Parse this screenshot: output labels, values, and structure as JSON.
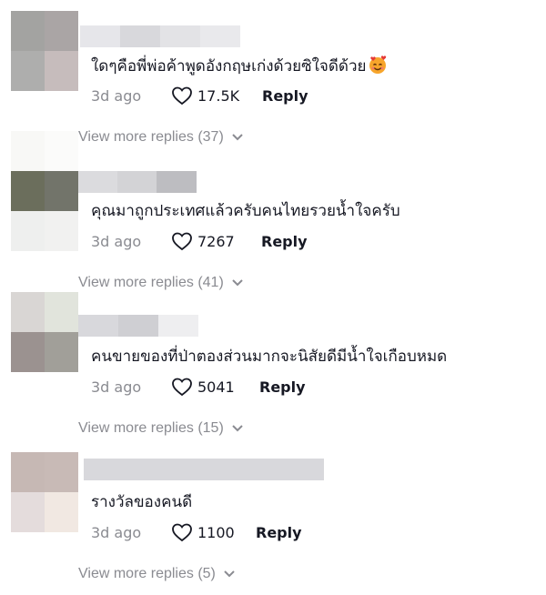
{
  "comments": [
    {
      "text": "ใดๆคือพี่พ่อค้าพูดอังกฤษเก่งด้วยซิใจดีด้วย",
      "emoji": "smiling-face-with-hearts",
      "time": "3d ago",
      "likes": "17.5K",
      "reply_label": "Reply",
      "more_replies": "View more replies (37)"
    },
    {
      "text": "คุณมาถูกประเทศแล้วครับคนไทยรวยน้ำใจครับ",
      "time": "3d ago",
      "likes": "7267",
      "reply_label": "Reply",
      "more_replies": "View more replies (41)"
    },
    {
      "text": "คนขายของที่ป่าตองส่วนมากจะนิสัยดีมีน้ำใจเกือบหมด",
      "time": "3d ago",
      "likes": "5041",
      "reply_label": "Reply",
      "more_replies": "View more replies (15)"
    },
    {
      "text": "รางวัลของคนดี",
      "time": "3d ago",
      "likes": "1100",
      "reply_label": "Reply",
      "more_replies": "View more replies (5)"
    }
  ],
  "colors": {
    "text": "#161823",
    "muted": "#8a8b91"
  }
}
